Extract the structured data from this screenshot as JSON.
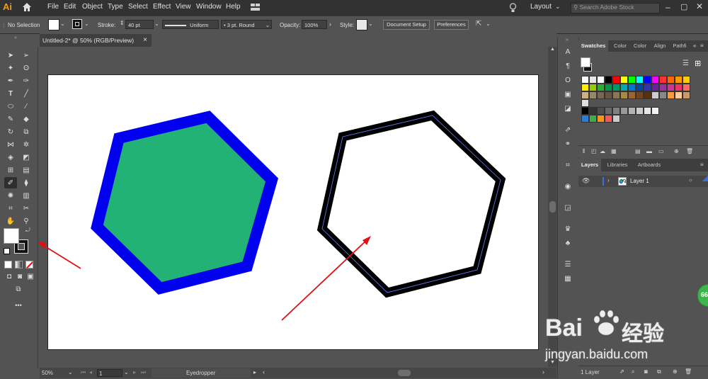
{
  "app": {
    "logo": "Ai"
  },
  "menu": [
    "File",
    "Edit",
    "Object",
    "Type",
    "Select",
    "Effect",
    "View",
    "Window",
    "Help"
  ],
  "header_right": {
    "workspace": "Layout",
    "search_placeholder": "Search Adobe Stock"
  },
  "control_bar": {
    "selection": "No Selection",
    "stroke_label": "Stroke:",
    "stroke_value": "40 pt",
    "stroke_profile": "Uniform",
    "brush": "3 pt. Round",
    "opacity_label": "Opacity:",
    "opacity_value": "100%",
    "style_label": "Style:",
    "document_setup": "Document Setup",
    "preferences": "Preferences"
  },
  "document": {
    "tab_title": "Untitled-2* @ 50% (RGB/Preview)",
    "close": "×"
  },
  "status": {
    "zoom": "50%",
    "artboard": "1",
    "tool": "Eyedropper"
  },
  "swatches_panel": {
    "tabs": [
      "Swatches",
      "Color",
      "Color",
      "Align",
      "Pathfi"
    ]
  },
  "layers_panel": {
    "tabs": [
      "Layers",
      "Libraries",
      "Artboards"
    ],
    "layer_name": "Layer 1",
    "footer": "1 Layer"
  },
  "colors": {
    "hexagon_fill": "#22b275",
    "hexagon_stroke": "#0000ee",
    "outline_stroke": "#000000",
    "arrow": "#e01010"
  },
  "watermark": {
    "brand": "Bai",
    "brand2": "经验",
    "url": "jingyan.baidu.com"
  },
  "badge": {
    "value": "66"
  }
}
